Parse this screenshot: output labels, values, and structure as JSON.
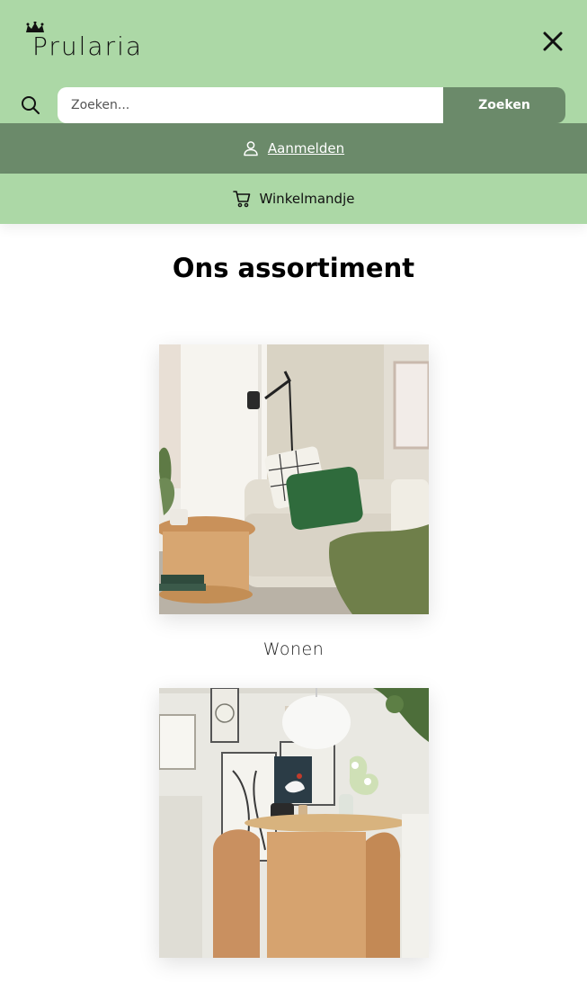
{
  "header": {
    "logo_text": "Prularia",
    "close_icon": "close-icon"
  },
  "search": {
    "placeholder": "Zoeken...",
    "button_label": "Zoeken",
    "icon": "search-icon"
  },
  "account": {
    "login_label": "Aanmelden",
    "icon": "user-icon"
  },
  "cart": {
    "label": "Winkelmandje",
    "icon": "cart-icon"
  },
  "main": {
    "title": "Ons assortiment",
    "categories": [
      {
        "label": "Wonen",
        "image": "living-room-sofa-photo"
      },
      {
        "label": "",
        "image": "dining-room-photo"
      }
    ]
  },
  "colors": {
    "header_bg": "#acd8a6",
    "accent_dark": "#6b8a6a",
    "white": "#ffffff"
  }
}
